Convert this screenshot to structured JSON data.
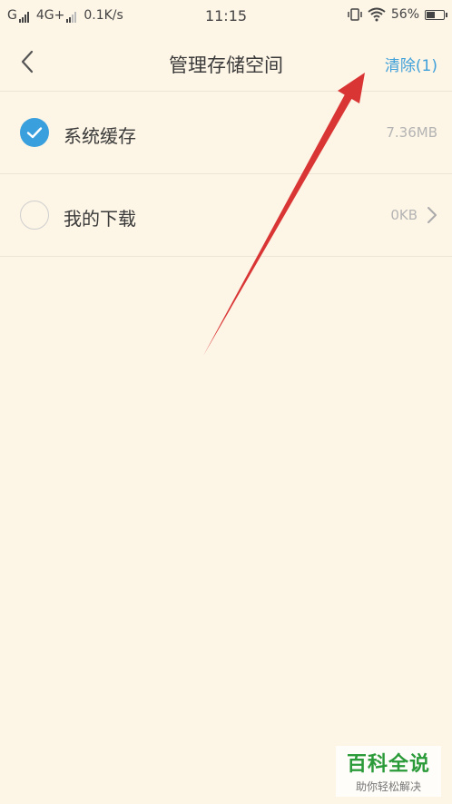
{
  "status_bar": {
    "carrier1": "G",
    "carrier2": "4G+",
    "speed": "0.1K/s",
    "time": "11:15",
    "battery": "56%",
    "battery_level": 0.56
  },
  "header": {
    "title": "管理存储空间",
    "clear_label": "清除(1)",
    "accent_color": "#3a9fdd"
  },
  "items": [
    {
      "label": "系统缓存",
      "size": "7.36MB",
      "checked": true
    },
    {
      "label": "我的下载",
      "size": "0KB",
      "checked": false
    }
  ],
  "watermark": {
    "main": "百科全说",
    "sub": "助你轻松解决"
  }
}
